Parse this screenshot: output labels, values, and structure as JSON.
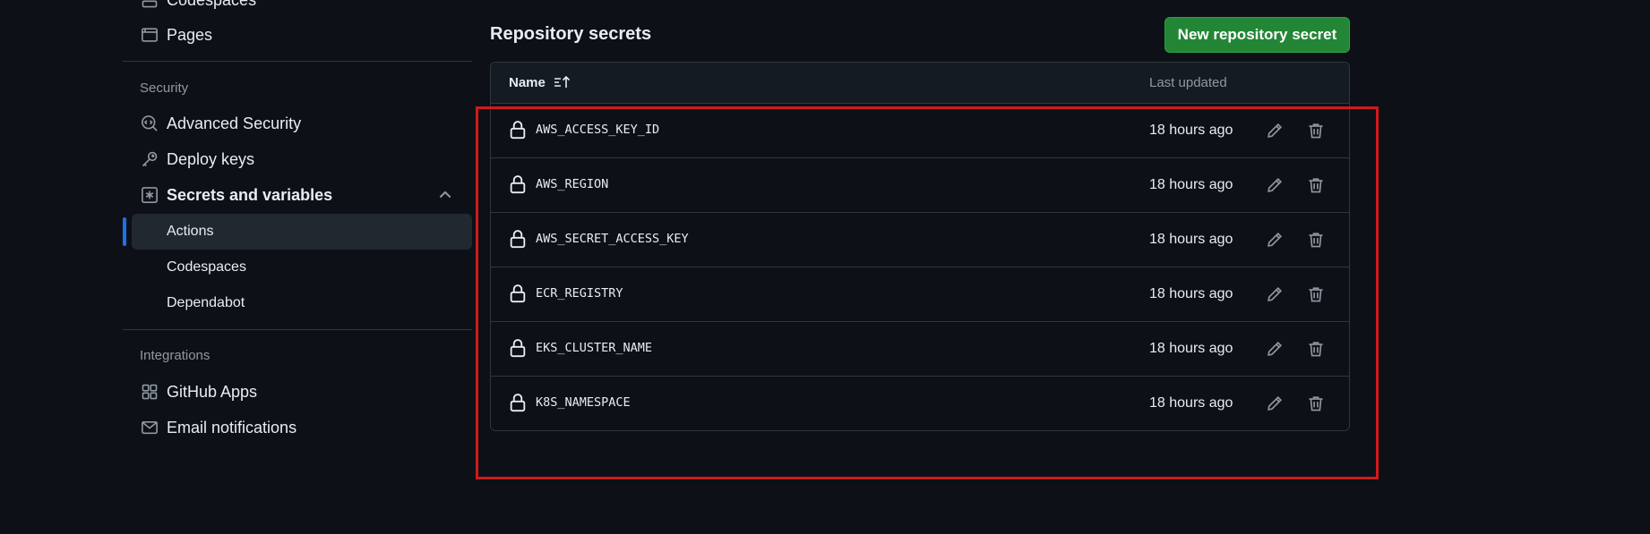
{
  "sidebar": {
    "top_items": [
      {
        "label": "Codespaces",
        "icon": "codespaces-icon"
      },
      {
        "label": "Pages",
        "icon": "browser-icon"
      }
    ],
    "security_section": {
      "label": "Security",
      "items": [
        {
          "label": "Advanced Security",
          "icon": "codescan-icon"
        },
        {
          "label": "Deploy keys",
          "icon": "key-icon"
        },
        {
          "label": "Secrets and variables",
          "icon": "key-asterisk-icon"
        }
      ],
      "sub_items": [
        {
          "label": "Actions",
          "active": true
        },
        {
          "label": "Codespaces",
          "active": false
        },
        {
          "label": "Dependabot",
          "active": false
        }
      ]
    },
    "integrations_section": {
      "label": "Integrations",
      "items": [
        {
          "label": "GitHub Apps",
          "icon": "apps-icon"
        },
        {
          "label": "Email notifications",
          "icon": "mail-icon"
        }
      ]
    }
  },
  "main": {
    "title": "Repository secrets",
    "new_button_label": "New repository secret",
    "table": {
      "columns": {
        "name": "Name",
        "last_updated": "Last updated"
      },
      "rows": [
        {
          "name": "AWS_ACCESS_KEY_ID",
          "updated": "18 hours ago"
        },
        {
          "name": "AWS_REGION",
          "updated": "18 hours ago"
        },
        {
          "name": "AWS_SECRET_ACCESS_KEY",
          "updated": "18 hours ago"
        },
        {
          "name": "ECR_REGISTRY",
          "updated": "18 hours ago"
        },
        {
          "name": "EKS_CLUSTER_NAME",
          "updated": "18 hours ago"
        },
        {
          "name": "K8S_NAMESPACE",
          "updated": "18 hours ago"
        }
      ]
    }
  },
  "colors": {
    "background": "#0d1117",
    "accent_green": "#238636",
    "active_indicator": "#1f6feb",
    "highlight_box": "#d11a1a"
  }
}
